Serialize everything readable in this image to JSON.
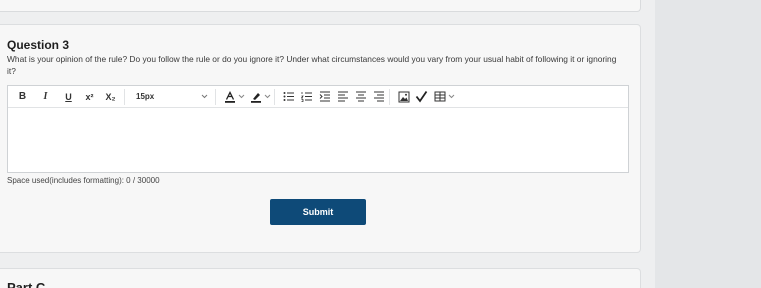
{
  "question": {
    "title": "Question 3",
    "text": "What is your opinion of the rule? Do you follow the rule or do you ignore it? Under what circumstances would you vary from your usual habit of following it or ignoring it?"
  },
  "toolbar": {
    "bold": "B",
    "italic": "I",
    "underline": "U",
    "superscript": "x²",
    "subscript": "X₂",
    "font_size": "15px",
    "icons": [
      "bold-icon",
      "italic-icon",
      "underline-icon",
      "superscript-icon",
      "subscript-icon",
      "font-color-icon",
      "highlight-icon",
      "bullet-list-icon",
      "numbered-list-icon",
      "indent-icon",
      "align-left-icon",
      "align-center-icon",
      "align-right-icon",
      "image-icon",
      "spellcheck-icon",
      "table-icon"
    ]
  },
  "editor": {
    "value": ""
  },
  "space_used": "Space used(includes formatting): 0 / 30000",
  "submit_label": "Submit",
  "next_section": {
    "title": "Part C"
  },
  "colors": {
    "primary": "#0e4a78",
    "background": "#eeeff0",
    "card": "#f7f7f7",
    "side_panel": "#e4e6e8"
  }
}
